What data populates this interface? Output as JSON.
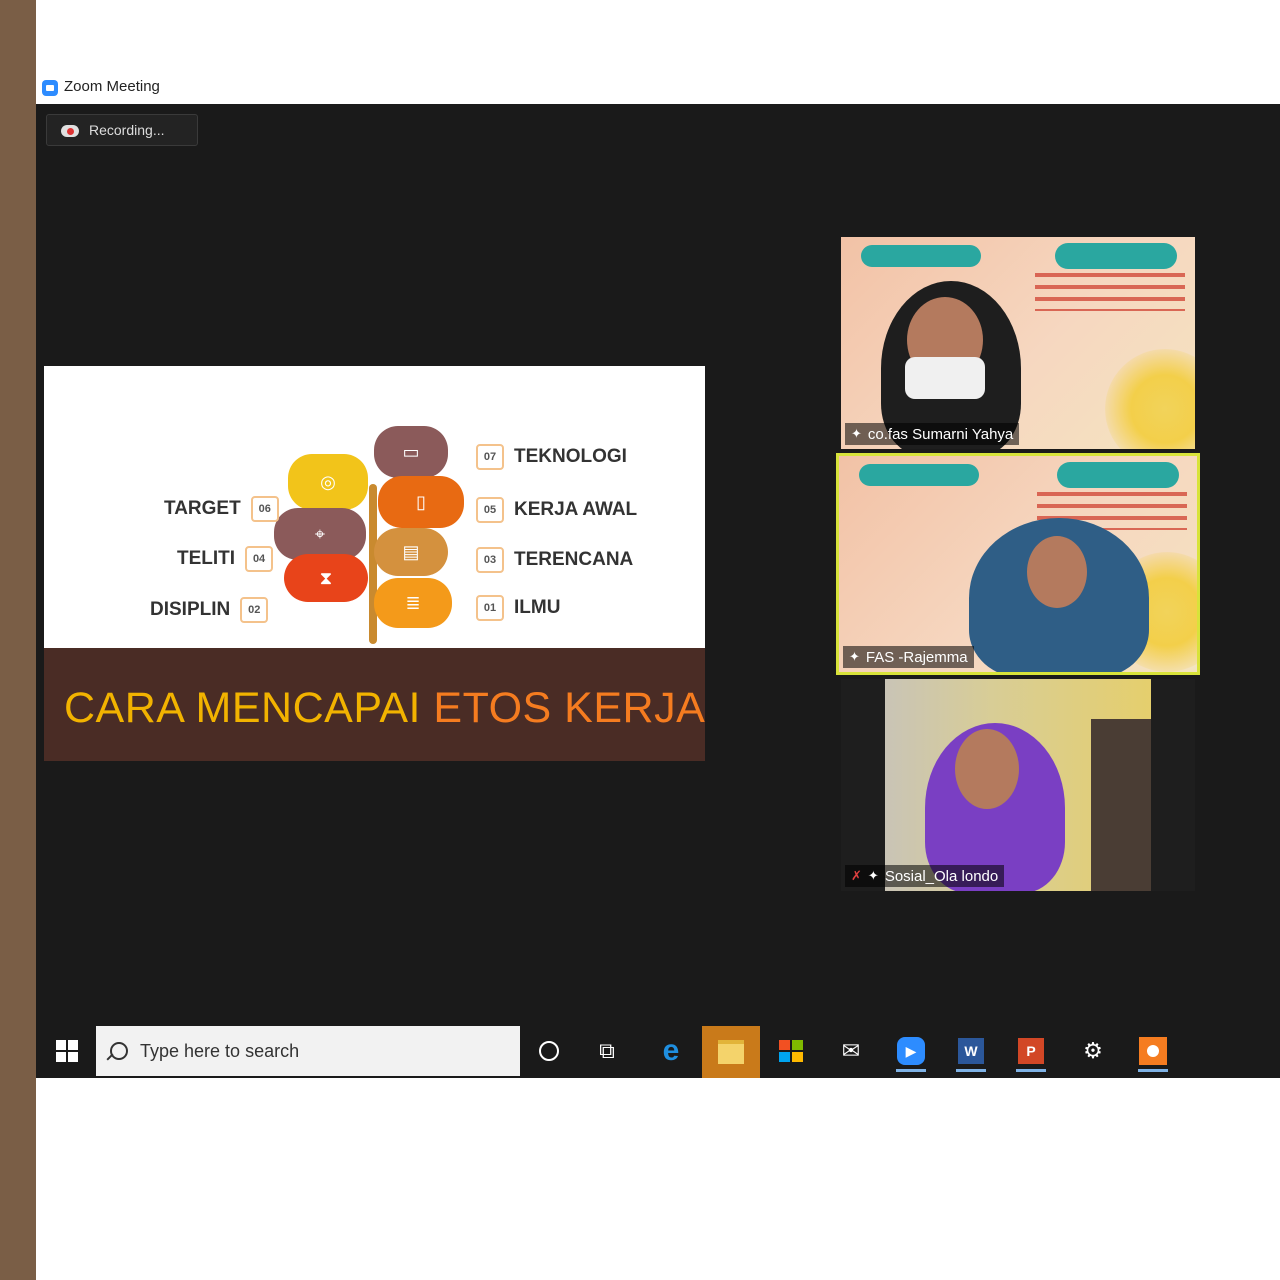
{
  "window": {
    "title": "Zoom Meeting"
  },
  "meeting": {
    "recording_label": "Recording..."
  },
  "slide": {
    "left_steps": [
      {
        "label": "TARGET",
        "num": "06"
      },
      {
        "label": "TELITI",
        "num": "04"
      },
      {
        "label": "DISIPLIN",
        "num": "02"
      }
    ],
    "right_steps": [
      {
        "label": "TEKNOLOGI",
        "num": "07"
      },
      {
        "label": "KERJA AWAL",
        "num": "05"
      },
      {
        "label": "TERENCANA",
        "num": "03"
      },
      {
        "label": "ILMU",
        "num": "01"
      }
    ],
    "footer_title_part1": "CARA MENCAPAI ",
    "footer_title_part2": "ETOS KERJA"
  },
  "participants": [
    {
      "name": "co.fas Sumarni Yahya",
      "muted": false,
      "active_speaker": false
    },
    {
      "name": "FAS -Rajemma",
      "muted": false,
      "active_speaker": true
    },
    {
      "name": "Sosial_Ola londo",
      "muted": true,
      "active_speaker": false
    }
  ],
  "taskbar": {
    "search_placeholder": "Type here to search",
    "icons": [
      "start-icon",
      "cortana-icon",
      "task-view-icon",
      "edge-icon",
      "file-explorer-icon",
      "store-icon",
      "mail-icon",
      "zoom-icon",
      "word-icon",
      "powerpoint-icon",
      "settings-icon",
      "app-icon"
    ]
  },
  "colors": {
    "accent_yellow": "#f2b300",
    "accent_orange": "#f57c20",
    "slide_footer": "#4a2c25",
    "active_speaker_border": "#d8e33a"
  }
}
